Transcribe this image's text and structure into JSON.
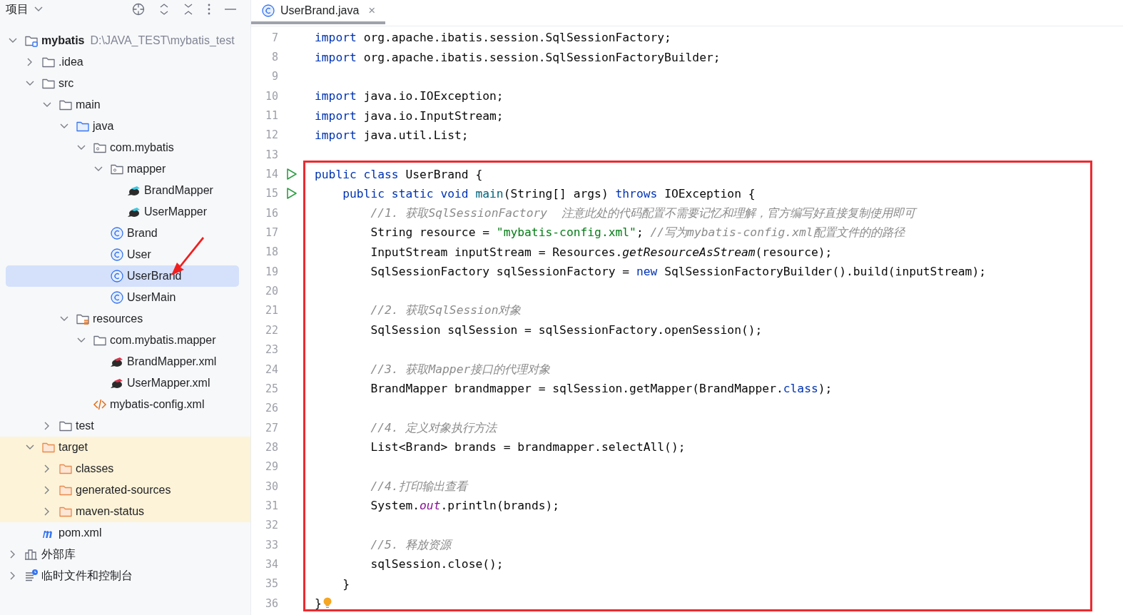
{
  "sidebar": {
    "title": "项目",
    "tree": [
      {
        "label": "mybatis",
        "kind": "module",
        "path": "D:\\JAVA_TEST\\mybatis_test",
        "expanded": true,
        "selected": false,
        "excluded": false,
        "children": [
          {
            "label": ".idea",
            "kind": "folder",
            "expanded": false,
            "selected": false,
            "excluded": false
          },
          {
            "label": "src",
            "kind": "folder",
            "expanded": true,
            "selected": false,
            "excluded": false,
            "children": [
              {
                "label": "main",
                "kind": "folder",
                "expanded": true,
                "selected": false,
                "excluded": false,
                "children": [
                  {
                    "label": "java",
                    "kind": "source-folder",
                    "expanded": true,
                    "selected": false,
                    "excluded": false,
                    "children": [
                      {
                        "label": "com.mybatis",
                        "kind": "package",
                        "expanded": true,
                        "selected": false,
                        "excluded": false,
                        "children": [
                          {
                            "label": "mapper",
                            "kind": "package",
                            "expanded": true,
                            "selected": false,
                            "excluded": false,
                            "children": [
                              {
                                "label": "BrandMapper",
                                "kind": "bird",
                                "selected": false,
                                "excluded": false
                              },
                              {
                                "label": "UserMapper",
                                "kind": "bird",
                                "selected": false,
                                "excluded": false
                              }
                            ]
                          },
                          {
                            "label": "Brand",
                            "kind": "class",
                            "selected": false,
                            "excluded": false
                          },
                          {
                            "label": "User",
                            "kind": "class",
                            "selected": false,
                            "excluded": false
                          },
                          {
                            "label": "UserBrand",
                            "kind": "class",
                            "selected": true,
                            "excluded": false
                          },
                          {
                            "label": "UserMain",
                            "kind": "class",
                            "selected": false,
                            "excluded": false
                          }
                        ]
                      }
                    ]
                  },
                  {
                    "label": "resources",
                    "kind": "resources-folder",
                    "expanded": true,
                    "selected": false,
                    "excluded": false,
                    "children": [
                      {
                        "label": "com.mybatis.mapper",
                        "kind": "folder",
                        "expanded": true,
                        "selected": false,
                        "excluded": false,
                        "children": [
                          {
                            "label": "BrandMapper.xml",
                            "kind": "bird-xml",
                            "selected": false,
                            "excluded": false
                          },
                          {
                            "label": "UserMapper.xml",
                            "kind": "bird-xml",
                            "selected": false,
                            "excluded": false
                          }
                        ]
                      },
                      {
                        "label": "mybatis-config.xml",
                        "kind": "xml",
                        "selected": false,
                        "excluded": false
                      }
                    ]
                  }
                ]
              },
              {
                "label": "test",
                "kind": "folder",
                "expanded": false,
                "selected": false,
                "excluded": false
              }
            ]
          },
          {
            "label": "target",
            "kind": "excluded-folder",
            "expanded": true,
            "selected": false,
            "excluded": true,
            "children": [
              {
                "label": "classes",
                "kind": "excluded-folder",
                "expanded": false,
                "selected": false,
                "excluded": true
              },
              {
                "label": "generated-sources",
                "kind": "excluded-folder",
                "expanded": false,
                "selected": false,
                "excluded": true
              },
              {
                "label": "maven-status",
                "kind": "excluded-folder",
                "expanded": false,
                "selected": false,
                "excluded": true
              }
            ]
          },
          {
            "label": "pom.xml",
            "kind": "maven",
            "selected": false,
            "excluded": false
          }
        ]
      },
      {
        "label": "外部库",
        "kind": "library",
        "expanded": false,
        "selected": false,
        "excluded": false
      },
      {
        "label": "临时文件和控制台",
        "kind": "scratch",
        "expanded": false,
        "selected": false,
        "excluded": false
      }
    ]
  },
  "editor": {
    "tabs": [
      {
        "label": "UserBrand.java",
        "close": "×",
        "selected": true
      }
    ],
    "lines": [
      {
        "number": "7",
        "tokens": [
          {
            "kind": "keyword",
            "text": "import"
          },
          {
            "kind": "plain",
            "text": " org.apache.ibatis.session.SqlSessionFactory;"
          }
        ]
      },
      {
        "number": "8",
        "tokens": [
          {
            "kind": "keyword",
            "text": "import"
          },
          {
            "kind": "plain",
            "text": " org.apache.ibatis.session.SqlSessionFactoryBuilder;"
          }
        ]
      },
      {
        "number": "9"
      },
      {
        "number": "10",
        "tokens": [
          {
            "kind": "keyword",
            "text": "import"
          },
          {
            "kind": "plain",
            "text": " java.io.IOException;"
          }
        ]
      },
      {
        "number": "11",
        "tokens": [
          {
            "kind": "keyword",
            "text": "import"
          },
          {
            "kind": "plain",
            "text": " java.io.InputStream;"
          }
        ]
      },
      {
        "number": "12",
        "tokens": [
          {
            "kind": "keyword",
            "text": "import"
          },
          {
            "kind": "plain",
            "text": " java.util.List;"
          }
        ]
      },
      {
        "number": "13"
      },
      {
        "number": "14",
        "runnable": true,
        "tokens": [
          {
            "kind": "keyword",
            "text": "public class"
          },
          {
            "kind": "plain",
            "text": " UserBrand {"
          }
        ]
      },
      {
        "number": "15",
        "runnable": true,
        "tokens": [
          {
            "kind": "keyword",
            "text": "    public static void "
          },
          {
            "kind": "method",
            "text": "main"
          },
          {
            "kind": "plain",
            "text": "(String[] args) "
          },
          {
            "kind": "keyword",
            "text": "throws"
          },
          {
            "kind": "plain",
            "text": " IOException {"
          }
        ]
      },
      {
        "number": "16",
        "tokens": [
          {
            "kind": "comment",
            "text": "        //1. 获取SqlSessionFactory  注意此处的代码配置不需要记忆和理解，官方编写好直接复制使用即可"
          }
        ]
      },
      {
        "number": "17",
        "tokens": [
          {
            "kind": "plain",
            "text": "        String resource = "
          },
          {
            "kind": "string",
            "text": "\"mybatis-config.xml\""
          },
          {
            "kind": "plain",
            "text": "; "
          },
          {
            "kind": "comment",
            "text": "//写为mybatis-config.xml配置文件的的路径"
          }
        ]
      },
      {
        "number": "18",
        "tokens": [
          {
            "kind": "plain",
            "text": "        InputStream inputStream = Resources."
          },
          {
            "kind": "static-method",
            "text": "getResourceAsStream"
          },
          {
            "kind": "plain",
            "text": "(resource);"
          }
        ]
      },
      {
        "number": "19",
        "tokens": [
          {
            "kind": "plain",
            "text": "        SqlSessionFactory sqlSessionFactory = "
          },
          {
            "kind": "keyword",
            "text": "new"
          },
          {
            "kind": "plain",
            "text": " SqlSessionFactoryBuilder().build(inputStream);"
          }
        ]
      },
      {
        "number": "20"
      },
      {
        "number": "21",
        "tokens": [
          {
            "kind": "comment",
            "text": "        //2. 获取SqlSession对象"
          }
        ]
      },
      {
        "number": "22",
        "tokens": [
          {
            "kind": "plain",
            "text": "        SqlSession sqlSession = sqlSessionFactory.openSession();"
          }
        ]
      },
      {
        "number": "23"
      },
      {
        "number": "24",
        "tokens": [
          {
            "kind": "comment",
            "text": "        //3. 获取Mapper接口的代理对象"
          }
        ]
      },
      {
        "number": "25",
        "tokens": [
          {
            "kind": "plain",
            "text": "        BrandMapper brandmapper = sqlSession.getMapper(BrandMapper."
          },
          {
            "kind": "keyword",
            "text": "class"
          },
          {
            "kind": "plain",
            "text": ");"
          }
        ]
      },
      {
        "number": "26"
      },
      {
        "number": "27",
        "tokens": [
          {
            "kind": "comment",
            "text": "        //4. 定义对象执行方法"
          }
        ]
      },
      {
        "number": "28",
        "tokens": [
          {
            "kind": "plain",
            "text": "        List<Brand> brands = brandmapper.selectAll();"
          }
        ]
      },
      {
        "number": "29"
      },
      {
        "number": "30",
        "tokens": [
          {
            "kind": "comment",
            "text": "        //4.打印输出查看"
          }
        ]
      },
      {
        "number": "31",
        "tokens": [
          {
            "kind": "plain",
            "text": "        System."
          },
          {
            "kind": "static-field",
            "text": "out"
          },
          {
            "kind": "plain",
            "text": ".println(brands);"
          }
        ]
      },
      {
        "number": "32"
      },
      {
        "number": "33",
        "tokens": [
          {
            "kind": "comment",
            "text": "        //5. 释放资源"
          }
        ]
      },
      {
        "number": "34",
        "tokens": [
          {
            "kind": "plain",
            "text": "        sqlSession.close();"
          }
        ]
      },
      {
        "number": "35",
        "tokens": [
          {
            "kind": "plain",
            "text": "    }"
          }
        ]
      },
      {
        "number": "36",
        "hint": true,
        "tokens": [
          {
            "kind": "plain",
            "text": "}"
          }
        ]
      }
    ]
  }
}
